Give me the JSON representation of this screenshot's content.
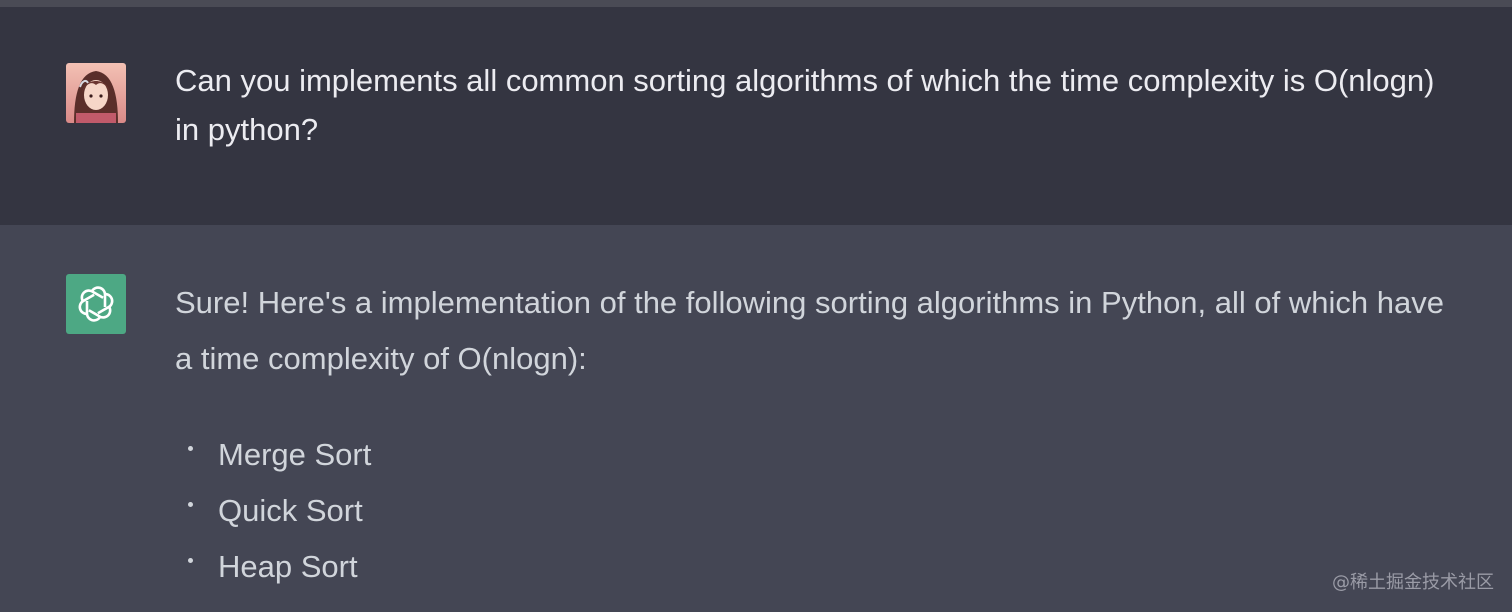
{
  "conversation": {
    "user_message": "Can you implements all common sorting algorithms of which the time complexity is O(nlogn) in python?",
    "assistant_intro": "Sure! Here's a implementation of the following sorting algorithms in Python, all of which have a time complexity of O(nlogn):",
    "algorithms": [
      "Merge Sort",
      "Quick Sort",
      "Heap Sort"
    ]
  },
  "icons": {
    "user_avatar": "user-avatar-anime",
    "assistant_avatar": "openai-logo-icon"
  },
  "colors": {
    "user_bg": "#343541",
    "assistant_bg": "#444654",
    "bot_avatar_bg": "#4da884"
  },
  "watermark": "@稀土掘金技术社区"
}
